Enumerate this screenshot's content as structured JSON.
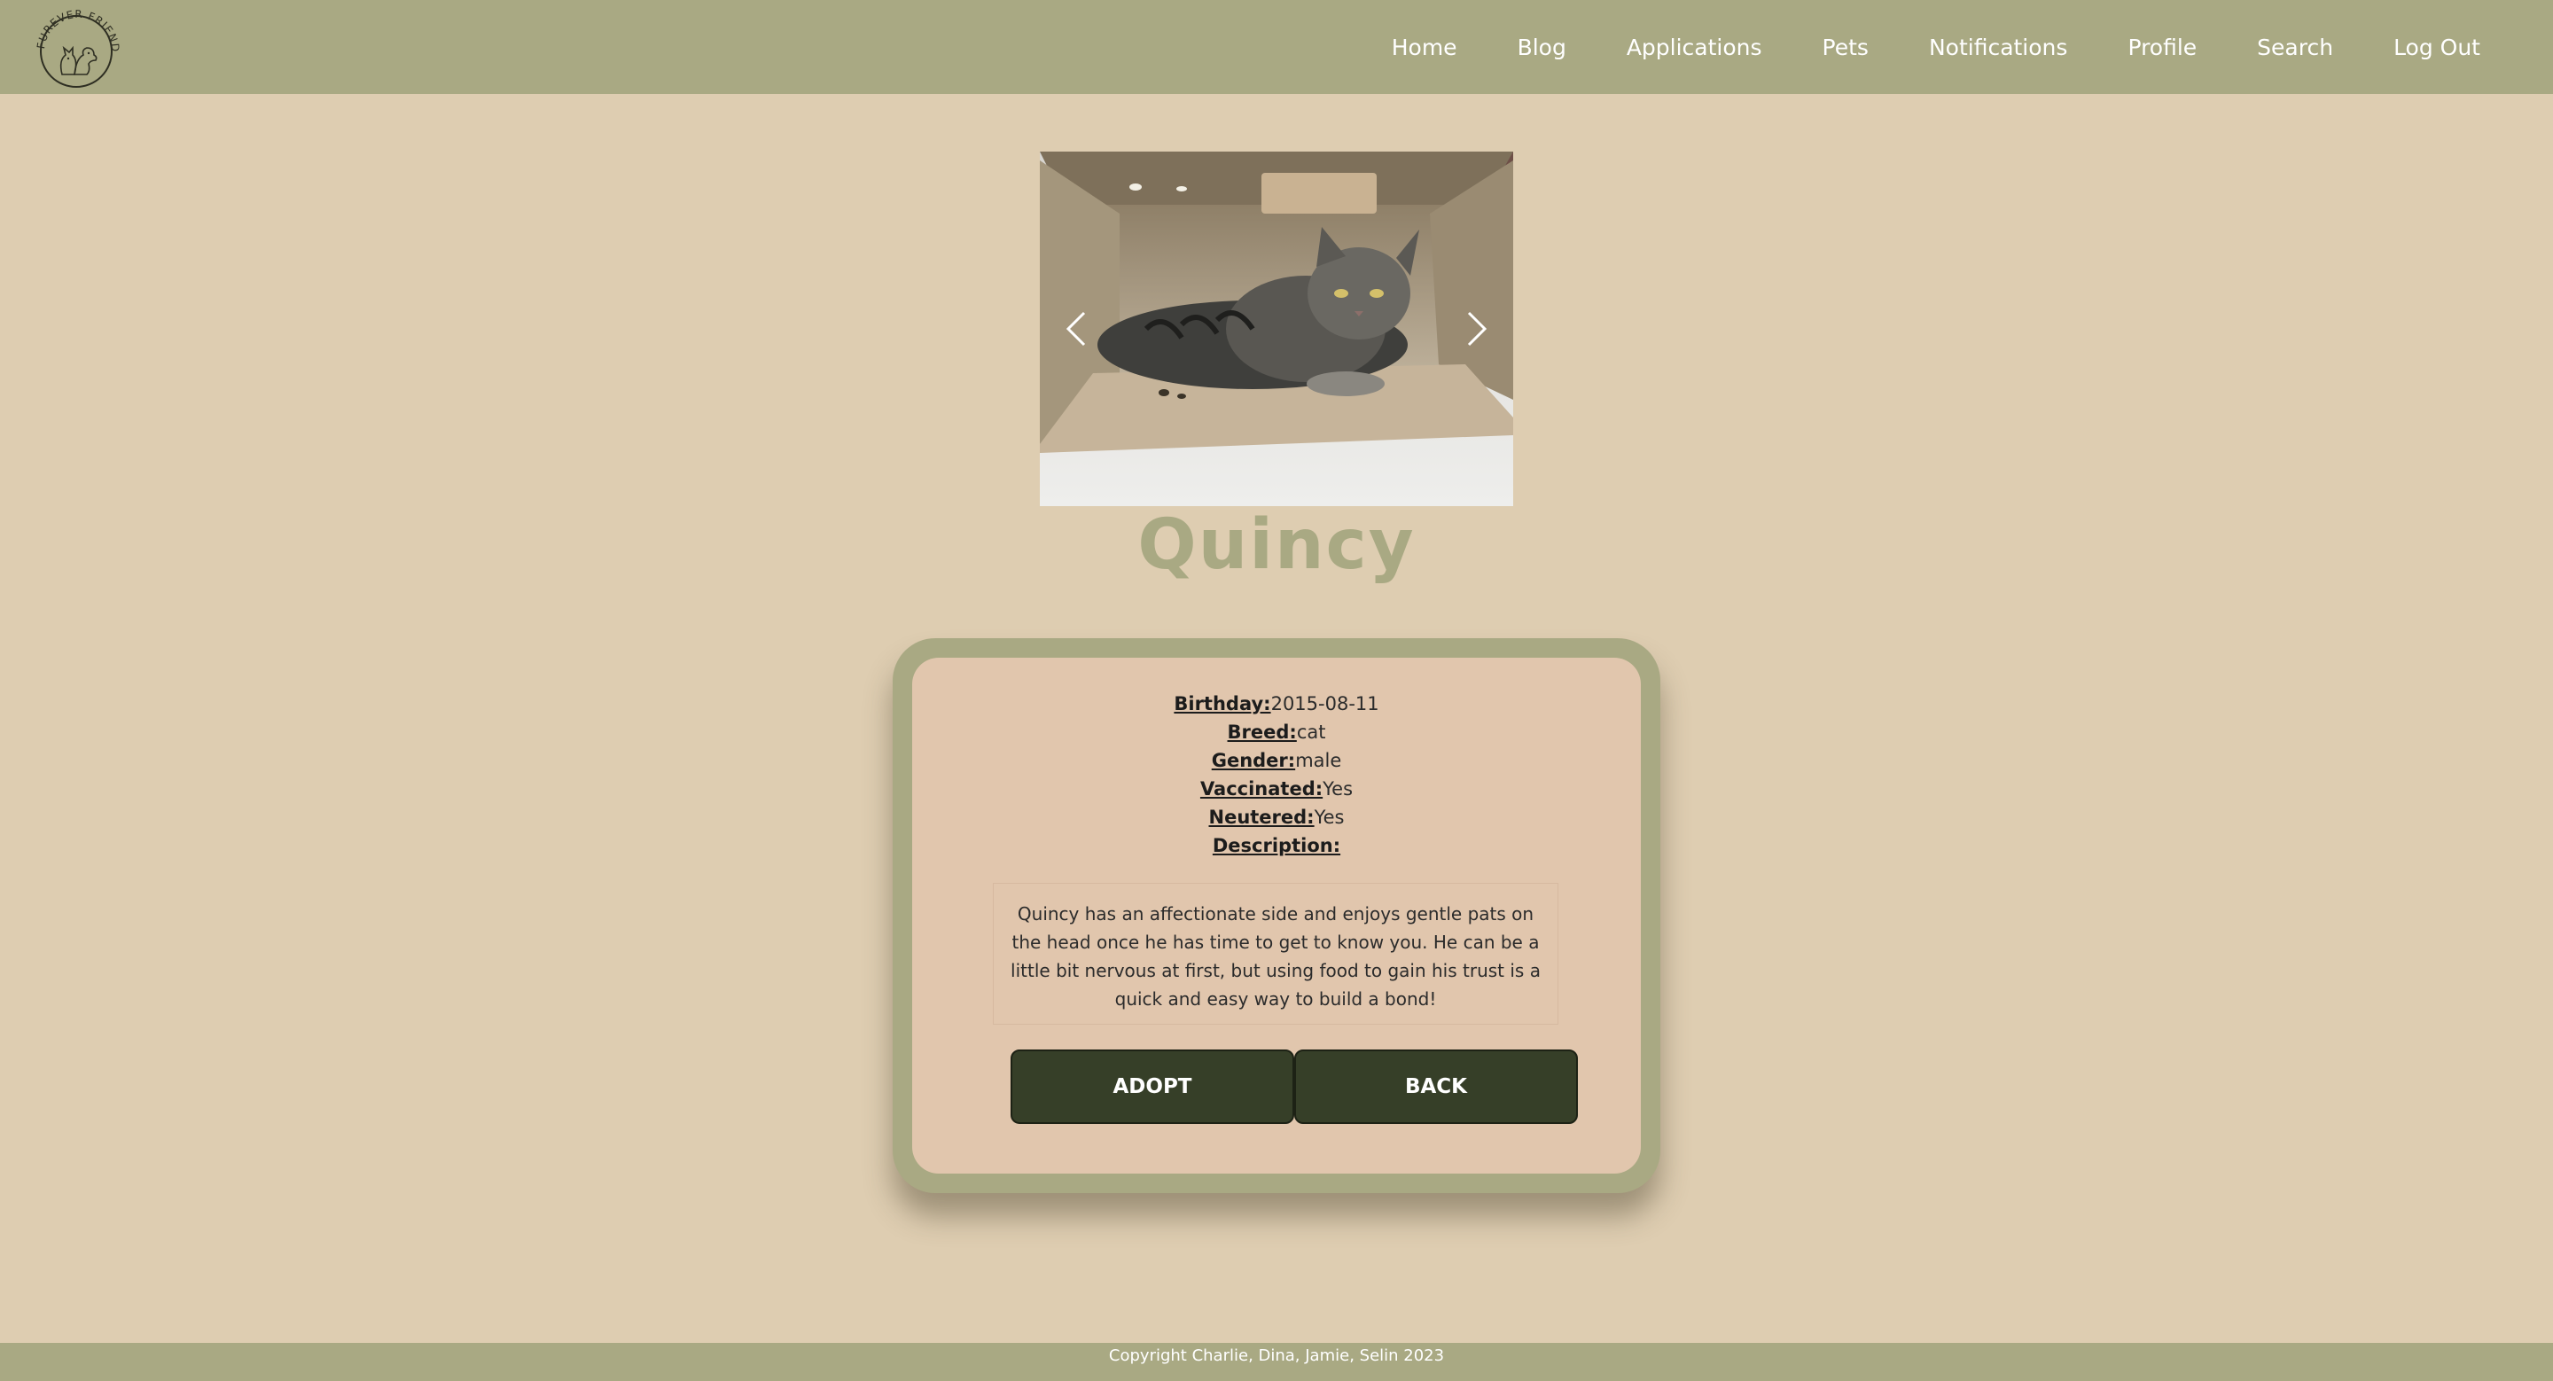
{
  "brand": {
    "logo_text": "FUREVER FRIENDS"
  },
  "nav": {
    "items": [
      {
        "label": "Home"
      },
      {
        "label": "Blog"
      },
      {
        "label": "Applications"
      },
      {
        "label": "Pets"
      },
      {
        "label": "Notifications"
      },
      {
        "label": "Profile"
      },
      {
        "label": "Search"
      },
      {
        "label": "Log Out"
      }
    ]
  },
  "carousel": {
    "prev_icon": "chevron-left-icon",
    "next_icon": "chevron-right-icon"
  },
  "pet": {
    "name": "Quincy",
    "fields": [
      {
        "label": "Birthday:",
        "value": "2015-08-11"
      },
      {
        "label": "Breed:",
        "value": "cat"
      },
      {
        "label": "Gender:",
        "value": "male"
      },
      {
        "label": "Vaccinated:",
        "value": "Yes"
      },
      {
        "label": "Neutered:",
        "value": "Yes"
      },
      {
        "label": "Description:",
        "value": ""
      }
    ],
    "description": "Quincy has an affectionate side and enjoys gentle pats on the head once he has time to get to know you. He can be a little bit nervous at first, but using food to gain his trust is a quick and easy way to build a bond!"
  },
  "actions": {
    "adopt_label": "ADOPT",
    "back_label": "BACK"
  },
  "footer": {
    "text": "Copyright Charlie, Dina, Jamie, Selin 2023"
  },
  "colors": {
    "background": "#decdb1",
    "navbar": "#a9a983",
    "card_inner": "#e1c6ad",
    "button": "#363f28",
    "title": "#a9a983"
  }
}
